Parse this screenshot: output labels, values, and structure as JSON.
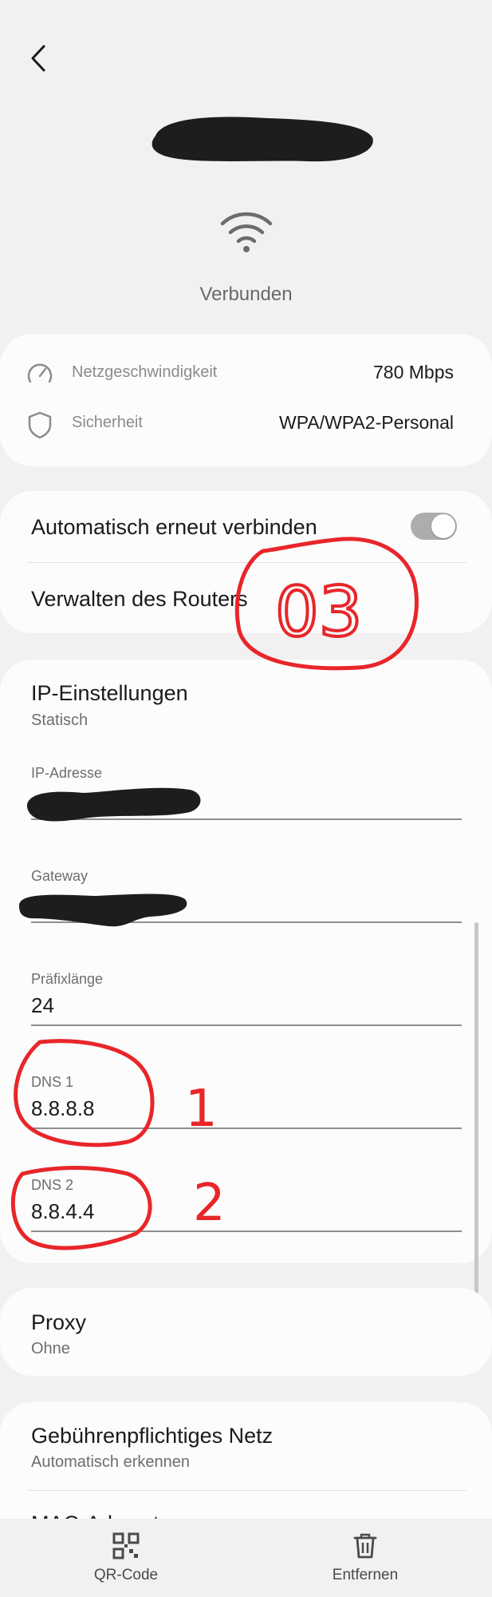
{
  "header": {
    "back_icon": "chevron-left-icon",
    "network_name": "",
    "wifi_icon": "wifi-icon",
    "status": "Verbunden"
  },
  "info": {
    "speed_label": "Netzgeschwindigkeit",
    "speed_value": "780 Mbps",
    "security_label": "Sicherheit",
    "security_value": "WPA/WPA2-Personal"
  },
  "connection": {
    "auto_reconnect_label": "Automatisch erneut verbinden",
    "auto_reconnect_on": true,
    "manage_router_label": "Verwalten des Routers"
  },
  "ip_settings": {
    "title": "IP-Einstellungen",
    "mode": "Statisch",
    "ip_label": "IP-Adresse",
    "ip_value": "",
    "gateway_label": "Gateway",
    "gateway_value": "",
    "prefix_label": "Präfixlänge",
    "prefix_value": "24",
    "dns1_label": "DNS 1",
    "dns1_value": "8.8.8.8",
    "dns2_label": "DNS 2",
    "dns2_value": "8.8.4.4"
  },
  "proxy": {
    "title": "Proxy",
    "value": "Ohne"
  },
  "metered": {
    "title": "Gebührenpflichtiges Netz",
    "value": "Automatisch erkennen",
    "next_item_partial": "MAC-Adresstyp"
  },
  "bottom_bar": {
    "qr_label": "QR-Code",
    "remove_label": "Entfernen"
  },
  "annotations": {
    "mark_1": "1",
    "mark_2": "2",
    "mark_03": "03",
    "color": "#e8262a"
  }
}
